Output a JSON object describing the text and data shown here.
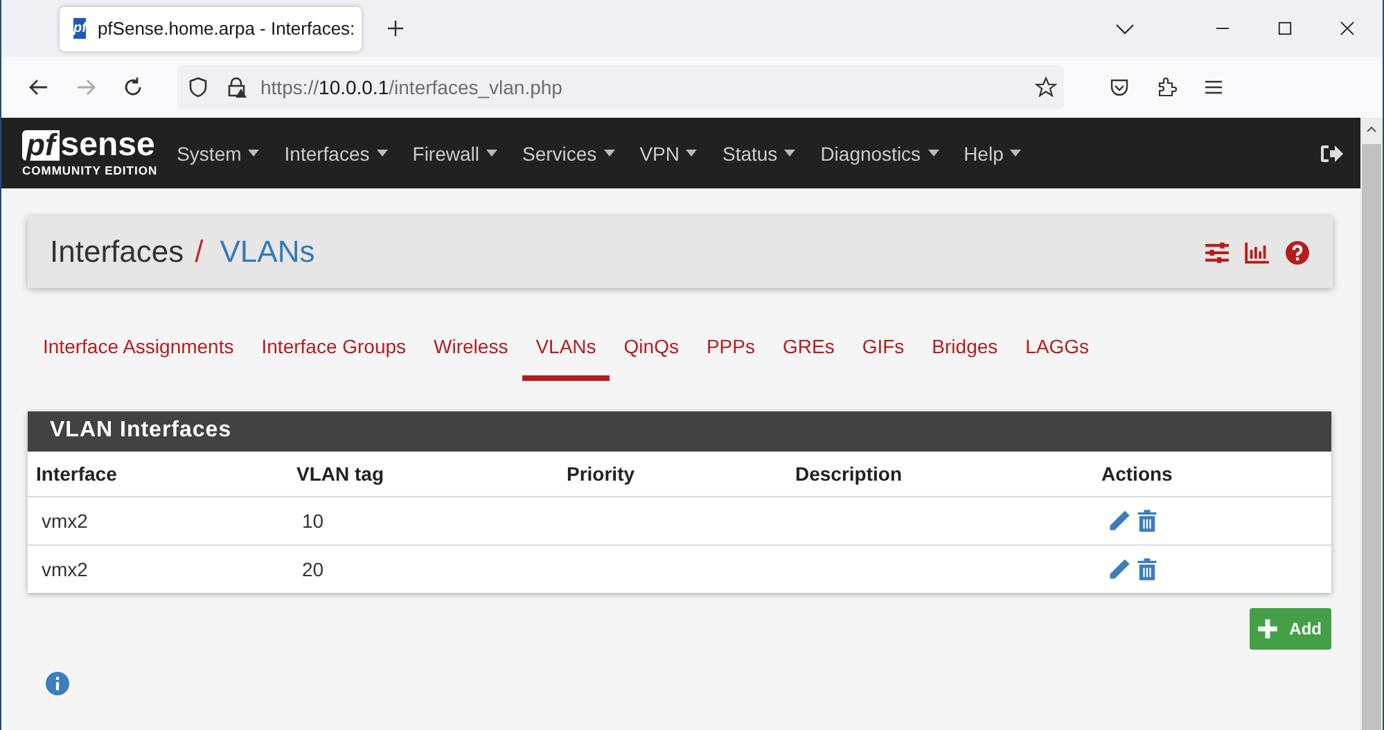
{
  "browser": {
    "tab_title": "pfSense.home.arpa - Interfaces:",
    "favicon_text": "pf",
    "url_scheme": "https://",
    "url_host": "10.0.0.1",
    "url_path": "/interfaces_vlan.php"
  },
  "navbar": {
    "logo_prefix": "pf",
    "logo_suffix": "sense",
    "edition": "COMMUNITY EDITION",
    "menus": [
      "System",
      "Interfaces",
      "Firewall",
      "Services",
      "VPN",
      "Status",
      "Diagnostics",
      "Help"
    ]
  },
  "breadcrumb": {
    "parent": "Interfaces",
    "separator": "/",
    "current": "VLANs"
  },
  "subtabs": [
    {
      "label": "Interface Assignments",
      "selected": false
    },
    {
      "label": "Interface Groups",
      "selected": false
    },
    {
      "label": "Wireless",
      "selected": false
    },
    {
      "label": "VLANs",
      "selected": true
    },
    {
      "label": "QinQs",
      "selected": false
    },
    {
      "label": "PPPs",
      "selected": false
    },
    {
      "label": "GREs",
      "selected": false
    },
    {
      "label": "GIFs",
      "selected": false
    },
    {
      "label": "Bridges",
      "selected": false
    },
    {
      "label": "LAGGs",
      "selected": false
    }
  ],
  "table": {
    "title": "VLAN Interfaces",
    "columns": [
      "Interface",
      "VLAN tag",
      "Priority",
      "Description",
      "Actions"
    ],
    "rows": [
      {
        "interface": "vmx2",
        "vlan_tag": "10"
      },
      {
        "interface": "vmx2",
        "vlan_tag": "20"
      }
    ]
  },
  "add_button": {
    "label": "Add"
  }
}
